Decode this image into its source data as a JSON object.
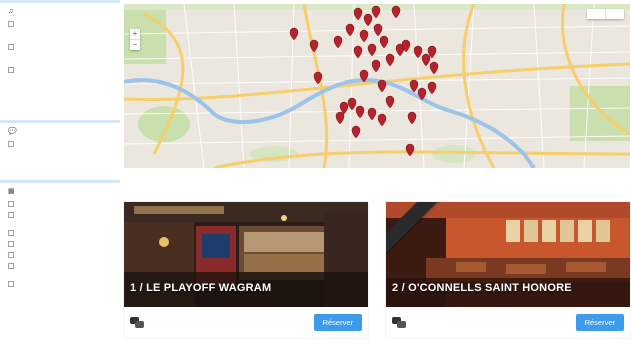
{
  "filters": {
    "ambiance": {
      "icon": "music-icon",
      "title": "",
      "options": [
        {
          "label": "",
          "description": ""
        },
        {
          "label": "",
          "description": ""
        },
        {
          "label": "",
          "description": ""
        }
      ]
    },
    "promotions": {
      "icon": "chat-bubbles-icon",
      "title": "",
      "option": {
        "label": ""
      }
    },
    "services": {
      "icon": "grid-icon",
      "title": "",
      "options": [
        {
          "label": ""
        },
        {
          "label": "",
          "description": ""
        },
        {
          "label": ""
        },
        {
          "label": ""
        },
        {
          "label": ""
        },
        {
          "label": "",
          "description": ""
        },
        {
          "label": "",
          "description": ""
        }
      ]
    }
  },
  "map": {
    "type_buttons": [
      "",
      ""
    ],
    "zoom_in": "+",
    "zoom_out": "−",
    "labels": [
      ""
    ],
    "caption": "",
    "colors": {
      "river": "#9cc3e8",
      "road_major": "#f6cf6b",
      "park": "#c9dfae",
      "marker": "#b4232b"
    }
  },
  "venues": [
    {
      "title": "1 / LE PLAYOFF WAGRAM",
      "subtitle": "",
      "meta": [
        "",
        ""
      ],
      "promo_label": "",
      "promo_offer": "",
      "button": "Réserver"
    },
    {
      "title": "2 / O'CONNELLS SAINT HONORE",
      "subtitle": "",
      "meta": [
        "",
        ""
      ],
      "ribbon": "",
      "promo_label": "",
      "promo_offer": "",
      "button": "Réserver"
    }
  ]
}
